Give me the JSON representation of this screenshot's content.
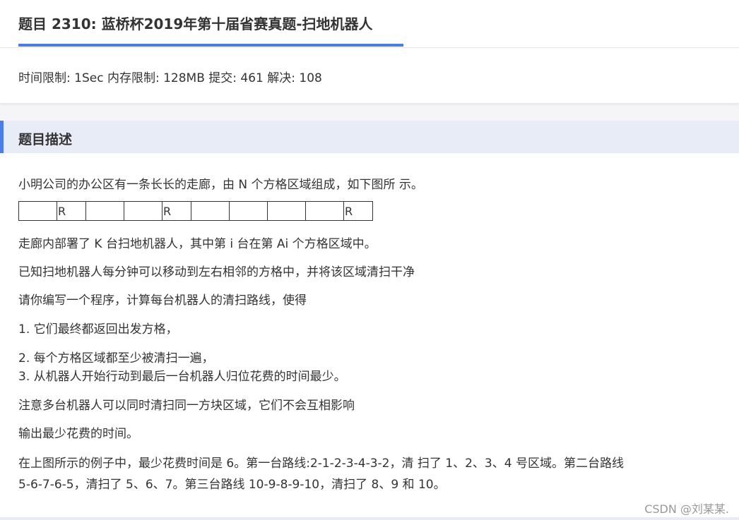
{
  "header": {
    "title": "题目 2310: 蓝桥杯2019年第十届省赛真题-扫地机器人",
    "stats": "时间限制: 1Sec 内存限制: 128MB 提交: 461 解决: 108"
  },
  "section": {
    "title": "题目描述"
  },
  "grid": {
    "cells": [
      "",
      "R",
      "",
      "",
      "R",
      "",
      "",
      "",
      "",
      "R"
    ]
  },
  "content": {
    "intro": "小明公司的办公区有一条长长的走廊，由 N 个方格区域组成，如下图所 示。",
    "line1": "走廊内部署了 K 台扫地机器人，其中第 i 台在第 Ai 个方格区域中。",
    "line2": "已知扫地机器人每分钟可以移动到左右相邻的方格中，并将该区域清扫干净",
    "line3": "请你编写一个程序，计算每台机器人的清扫路线，使得",
    "rule1": "1. 它们最终都返回出发方格，",
    "rule2": "2. 每个方格区域都至少被清扫一遍，",
    "rule3": "3. 从机器人开始行动到最后一台机器人归位花费的时间最少。",
    "line4": "注意多台机器人可以同时清扫同一方块区域，它们不会互相影响",
    "line5": "输出最少花费的时间。",
    "example1": "在上图所示的例子中，最少花费时间是 6。第一台路线:2-1-2-3-4-3-2，清 扫了 1、2、3、4 号区域。第二台路线",
    "example2": "5-6-7-6-5，清扫了 5、6、7。第三台路线 10-9-8-9-10，清扫了 8、9 和 10。"
  },
  "watermark": "CSDN @刘某某."
}
